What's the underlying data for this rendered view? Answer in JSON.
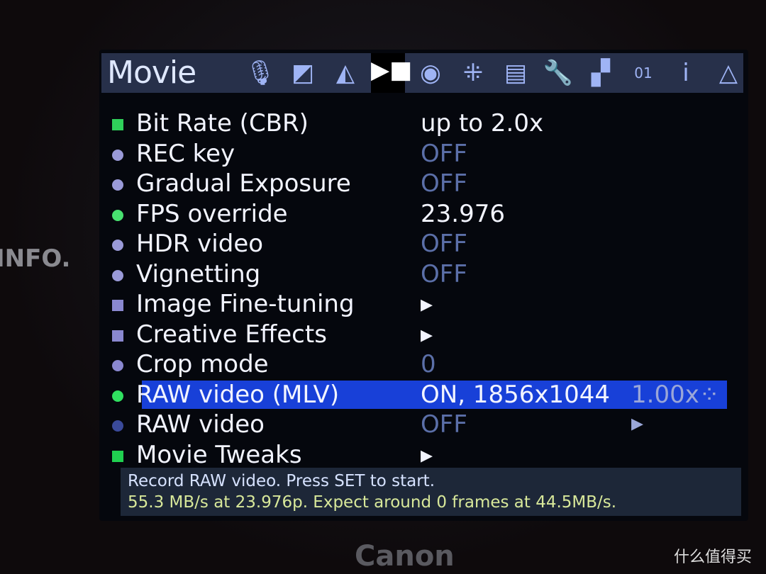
{
  "camera": {
    "info_label": "INFO.",
    "brand": "Canon",
    "watermark": "什么值得买"
  },
  "header": {
    "title": "Movie",
    "tabs": [
      {
        "icon": "microphone-icon",
        "glyph": "🎙"
      },
      {
        "icon": "exposure-icon",
        "glyph": "◩"
      },
      {
        "icon": "histogram-icon",
        "glyph": "◭"
      },
      {
        "icon": "movie-camera-icon",
        "glyph": "▶■",
        "active": true
      },
      {
        "icon": "camera-icon",
        "glyph": "◉"
      },
      {
        "icon": "focus-icon",
        "glyph": "⁜"
      },
      {
        "icon": "display-icon",
        "glyph": "▤"
      },
      {
        "icon": "wrench-icon",
        "glyph": "🔧"
      },
      {
        "icon": "modules-icon",
        "glyph": "▞"
      },
      {
        "icon": "debug-icon",
        "glyph": "01"
      },
      {
        "icon": "info-icon",
        "glyph": "i"
      },
      {
        "icon": "delta-icon",
        "glyph": "△"
      }
    ]
  },
  "menu": {
    "items": [
      {
        "label": "Bit Rate (CBR)",
        "value": "up to 2.0x",
        "ind": "square",
        "color": "#2fd05a",
        "dim": false
      },
      {
        "label": "REC key",
        "value": "OFF",
        "ind": "circle",
        "color": "#9a9ad8",
        "dim": true
      },
      {
        "label": "Gradual Exposure",
        "value": "OFF",
        "ind": "circle",
        "color": "#9a9ad8",
        "dim": true
      },
      {
        "label": "FPS override",
        "value": "23.976",
        "ind": "circle",
        "color": "#48e070",
        "dim": false
      },
      {
        "label": "HDR video",
        "value": "OFF",
        "ind": "circle",
        "color": "#9a9ad8",
        "dim": true
      },
      {
        "label": "Vignetting",
        "value": "OFF",
        "ind": "circle",
        "color": "#9a9ad8",
        "dim": true
      },
      {
        "label": "Image Fine-tuning",
        "value": "▸",
        "ind": "square",
        "color": "#8a88d0",
        "dim": false
      },
      {
        "label": "Creative Effects",
        "value": "▸",
        "ind": "square",
        "color": "#8a88d0",
        "dim": false
      },
      {
        "label": "Crop mode",
        "value": "0",
        "ind": "circle",
        "color": "#8a88d0",
        "dim": true
      },
      {
        "label": "RAW video (MLV)",
        "value": "ON, 1856x1044",
        "extra": "1.00x⁘▸",
        "ind": "circle",
        "color": "#30e060",
        "dim": false,
        "selected": true
      },
      {
        "label": "RAW video",
        "value": "OFF",
        "ind": "circle",
        "color": "#3a4a9a",
        "dim": true
      },
      {
        "label": "Movie Tweaks",
        "value": "▸",
        "ind": "square",
        "color": "#20d050",
        "dim": false
      }
    ]
  },
  "footer": {
    "help": "Record RAW video. Press SET to start.",
    "status": "55.3 MB/s at 23.976p. Expect around 0 frames at 44.5MB/s."
  }
}
